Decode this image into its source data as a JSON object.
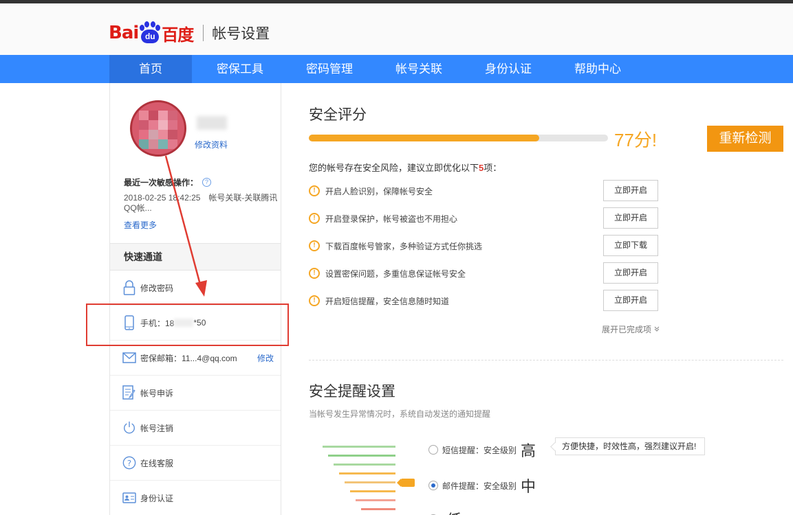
{
  "header": {
    "logo_bai": "Bai",
    "logo_du": "du",
    "logo_cn": "百度",
    "title": "帐号设置"
  },
  "nav": [
    "首页",
    "密保工具",
    "密码管理",
    "帐号关联",
    "身份认证",
    "帮助中心"
  ],
  "sidebar": {
    "edit_profile": "修改资料",
    "recent_title": "最近一次敏感操作：",
    "recent_text": "2018-02-25 18:42:25　帐号关联-关联腾讯QQ帐...",
    "view_more": "查看更多",
    "quick_title": "快速通道",
    "items": [
      {
        "label": "修改密码",
        "icon": "lock-icon"
      },
      {
        "label_prefix": "手机：18",
        "label_suffix": "*50",
        "icon": "phone-icon"
      },
      {
        "label": "密保邮箱：11...4@qq.com",
        "action": "修改",
        "icon": "mail-icon"
      },
      {
        "label": "帐号申诉",
        "icon": "document-edit-icon"
      },
      {
        "label": "帐号注销",
        "icon": "power-icon"
      },
      {
        "label": "在线客服",
        "icon": "help-icon"
      },
      {
        "label": "身份认证",
        "icon": "id-card-icon"
      }
    ]
  },
  "security": {
    "title": "安全评分",
    "score": 77,
    "score_text": "77分!",
    "recheck": "重新检测",
    "risk_prefix": "您的帐号存在安全风险，建议立即优化以下",
    "risk_count": "5",
    "risk_suffix": "项：",
    "tasks": [
      {
        "text": "开启人脸识别，保障帐号安全",
        "button": "立即开启"
      },
      {
        "text": "开启登录保护，帐号被盗也不用担心",
        "button": "立即开启"
      },
      {
        "text": "下载百度帐号管家，多种验证方式任你挑选",
        "button": "立即下载"
      },
      {
        "text": "设置密保问题，多重信息保证帐号安全",
        "button": "立即开启"
      },
      {
        "text": "开启短信提醒，安全信息随时知道",
        "button": "立即开启"
      }
    ],
    "expand": "展开已完成项",
    "warn_glyph": "!"
  },
  "reminder": {
    "title": "安全提醒设置",
    "subtitle": "当帐号发生异常情况时，系统自动发送的通知提醒",
    "options": [
      {
        "label": "短信提醒：安全级别",
        "level": "高",
        "selected": false
      },
      {
        "label": "邮件提醒：安全级别",
        "level": "中",
        "selected": true
      },
      {
        "label": "",
        "level": "低",
        "selected": false
      }
    ],
    "tooltip": "方便快捷，时效性高，强烈建议开启!"
  },
  "colors": {
    "nav_blue": "#3388ff",
    "score_orange": "#f5a623",
    "annotation_red": "#e03c32"
  }
}
